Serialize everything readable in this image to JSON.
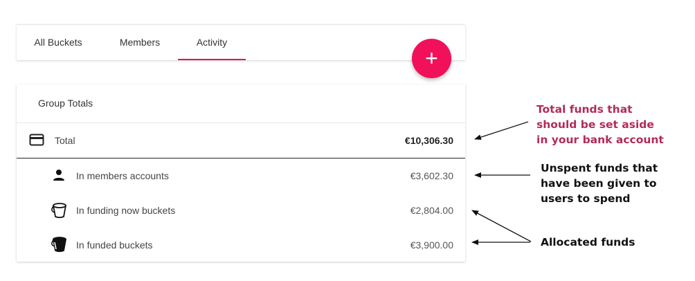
{
  "tabs": [
    {
      "label": "All Buckets"
    },
    {
      "label": "Members"
    },
    {
      "label": "Activity",
      "active": true
    }
  ],
  "fab": {
    "label": "+"
  },
  "group_totals": {
    "title": "Group Totals",
    "total": {
      "icon": "credit-card-icon",
      "label": "Total",
      "amount": "€10,306.30"
    },
    "rows": [
      {
        "icon": "person-icon",
        "label": "In members accounts",
        "amount": "€3,602.30"
      },
      {
        "icon": "empty-bucket-icon",
        "label": "In funding now buckets",
        "amount": "€2,804.00"
      },
      {
        "icon": "full-bucket-icon",
        "label": "In funded buckets",
        "amount": "€3,900.00"
      }
    ]
  },
  "annotations": {
    "total_funds": [
      "Total funds that",
      "should be set aside",
      "in your bank account"
    ],
    "unspent_funds": [
      "Unspent funds that",
      "have been given to",
      "users to spend"
    ],
    "allocated_funds": [
      "Allocated funds"
    ]
  },
  "colors": {
    "accent": "#e8115b",
    "fab": "#f0115a",
    "annotation_red": "#b22c57"
  }
}
